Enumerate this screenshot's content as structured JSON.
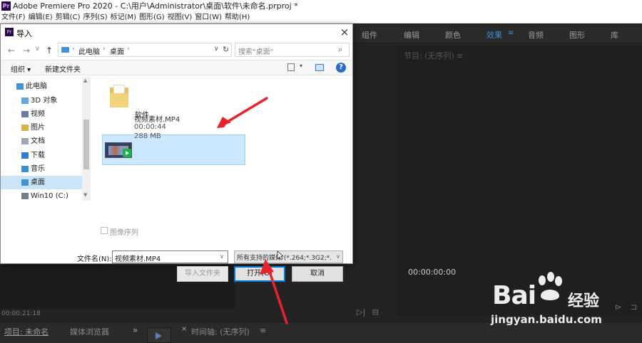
{
  "app": {
    "logo_text": "Pr",
    "title": "Adobe Premiere Pro 2020 - C:\\用户\\Administrator\\桌面\\软件\\未命名.prproj *",
    "menu": [
      "文件(F)",
      "编辑(E)",
      "剪辑(C)",
      "序列(S)",
      "标记(M)",
      "图形(G)",
      "视图(V)",
      "窗口(W)",
      "帮助(H)"
    ]
  },
  "workspaces": {
    "tabs": [
      "组件",
      "编辑",
      "颜色",
      "效果",
      "音频",
      "图形",
      "库"
    ],
    "active": "效果",
    "menu_glyph": "≡"
  },
  "program_monitor": {
    "title": "节目: (无序列) ≡",
    "timecode": "00:00:00:00",
    "icons": [
      "⊳",
      "⊐"
    ]
  },
  "source_panel": {
    "timecode": "00:00:21:18",
    "icons": [
      "▷|",
      "⊟"
    ]
  },
  "bottom_panel": {
    "tab_project": "项目: 未命名",
    "tab_media_browser": "媒体浏览器",
    "overflow_glyph": "»",
    "timeline_close": "×",
    "timeline_title": "时间轴: (无序列)",
    "timeline_menu": "≡"
  },
  "dialog": {
    "logo_text": "Pr",
    "title": "导入",
    "close_glyph": "×",
    "nav": {
      "back": "←",
      "forward": "→",
      "dropdown": "∨",
      "up": "↑"
    },
    "address": {
      "crumbs": [
        "此电脑",
        "桌面"
      ],
      "separator": "›",
      "dropdown": "∨",
      "refresh": "↻"
    },
    "search_placeholder": "搜索\"桌面\"",
    "search_glyph": "⌕",
    "toolbar": {
      "organize": "组织 ▾",
      "new_folder": "新建文件夹",
      "view_dropdown": "▾",
      "help": "?"
    },
    "tree": [
      {
        "label": "此电脑",
        "icon_color": "#3f93d8",
        "indent": 0
      },
      {
        "label": "3D 对象",
        "icon_color": "#5fa8e0",
        "indent": 1
      },
      {
        "label": "视频",
        "icon_color": "#6a7fa0",
        "indent": 1
      },
      {
        "label": "图片",
        "icon_color": "#d9b04a",
        "indent": 1
      },
      {
        "label": "文档",
        "icon_color": "#9aa7b8",
        "indent": 1
      },
      {
        "label": "下载",
        "icon_color": "#2f7bd6",
        "indent": 1
      },
      {
        "label": "音乐",
        "icon_color": "#3b8fd6",
        "indent": 1
      },
      {
        "label": "桌面",
        "icon_color": "#3f93d8",
        "indent": 1,
        "selected": true
      },
      {
        "label": "Win10 (C:)",
        "icon_color": "#6f7f90",
        "indent": 1
      }
    ],
    "scroll_up": "▲",
    "scroll_down": "▼",
    "folder": {
      "name": "软件"
    },
    "file": {
      "name": "视频素材.MP4",
      "duration": "00:00:44",
      "size": "288 MB"
    },
    "image_sequence_label": "图像序列",
    "filename_label": "文件名(N):",
    "filename_value": "视频素材.MP4",
    "dropdown_glyph": "∨",
    "filter_value": "所有支持的媒体 (*.264;*.3G2;*.",
    "buttons": {
      "import_folder": "导入文件夹",
      "open": "打开(O)",
      "cancel": "取消"
    }
  },
  "watermark": {
    "brand_left": "Bai",
    "brand_right": "经验",
    "url": "jingyan.baidu.com"
  }
}
